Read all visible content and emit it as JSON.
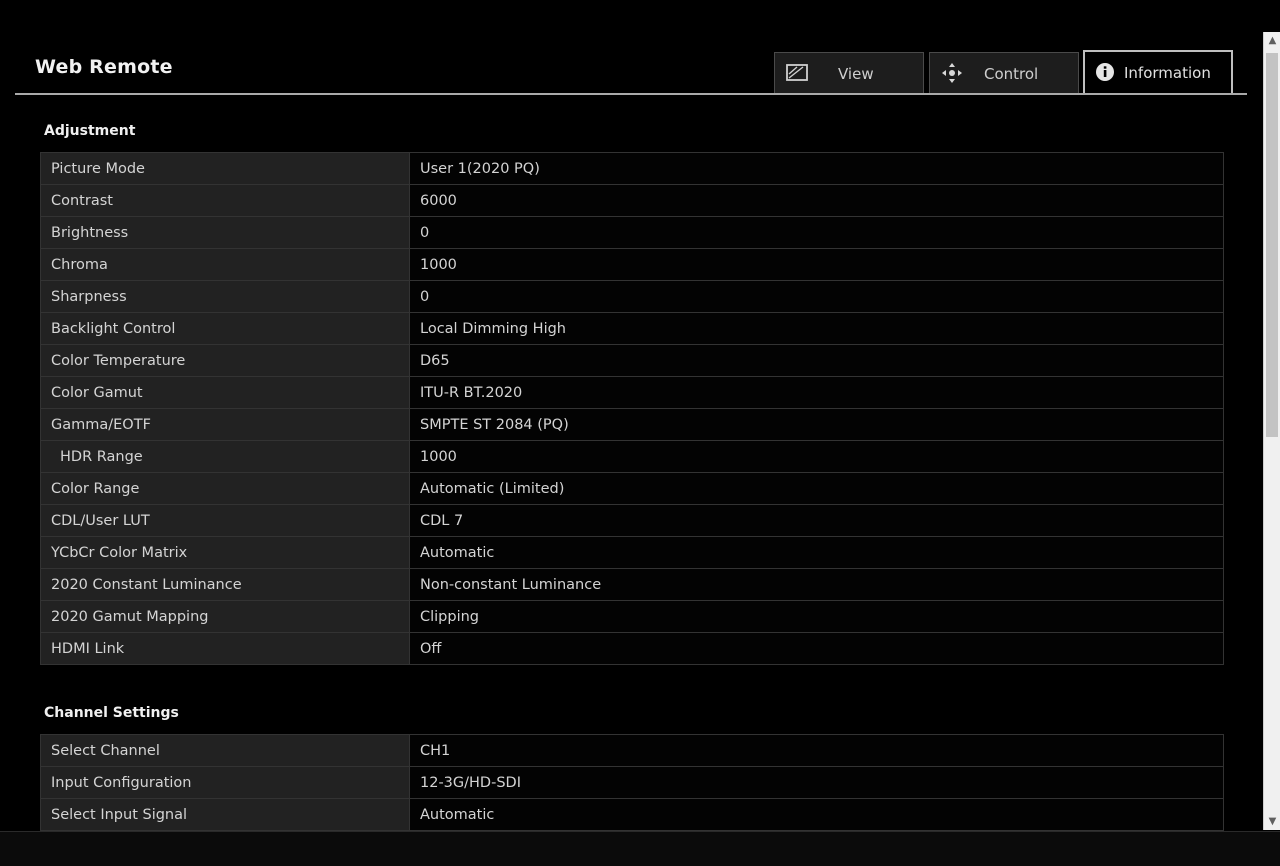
{
  "app": {
    "title": "Web Remote"
  },
  "tabs": {
    "view": "View",
    "control": "Control",
    "information": "Information",
    "active": "information"
  },
  "sections": {
    "adjustment": {
      "title": "Adjustment",
      "rows": [
        {
          "label": "Picture Mode",
          "value": "User 1(2020 PQ)"
        },
        {
          "label": "Contrast",
          "value": "6000"
        },
        {
          "label": "Brightness",
          "value": "0"
        },
        {
          "label": "Chroma",
          "value": "1000"
        },
        {
          "label": "Sharpness",
          "value": "0"
        },
        {
          "label": "Backlight Control",
          "value": "Local Dimming High"
        },
        {
          "label": "Color Temperature",
          "value": "D65"
        },
        {
          "label": "Color Gamut",
          "value": "ITU-R BT.2020"
        },
        {
          "label": "Gamma/EOTF",
          "value": "SMPTE ST 2084 (PQ)"
        },
        {
          "label": "HDR Range",
          "value": "1000"
        },
        {
          "label": "Color Range",
          "value": "Automatic (Limited)"
        },
        {
          "label": "CDL/User LUT",
          "value": "CDL 7"
        },
        {
          "label": "YCbCr Color Matrix",
          "value": "Automatic"
        },
        {
          "label": "2020 Constant Luminance",
          "value": "Non-constant Luminance"
        },
        {
          "label": "2020 Gamut Mapping",
          "value": "Clipping"
        },
        {
          "label": "HDMI Link",
          "value": "Off"
        }
      ]
    },
    "channel_settings": {
      "title": "Channel Settings",
      "rows": [
        {
          "label": "Select Channel",
          "value": "CH1"
        },
        {
          "label": "Input Configuration",
          "value": "12-3G/HD-SDI"
        },
        {
          "label": "Select Input Signal",
          "value": "Automatic"
        }
      ]
    }
  },
  "icons": {
    "view": "monitor-icon",
    "control": "move-arrows-icon",
    "information": "info-icon"
  },
  "colors": {
    "background": "#000000",
    "label_cell": "#222222",
    "value_cell": "#030303",
    "text": "#d4d4d4"
  }
}
